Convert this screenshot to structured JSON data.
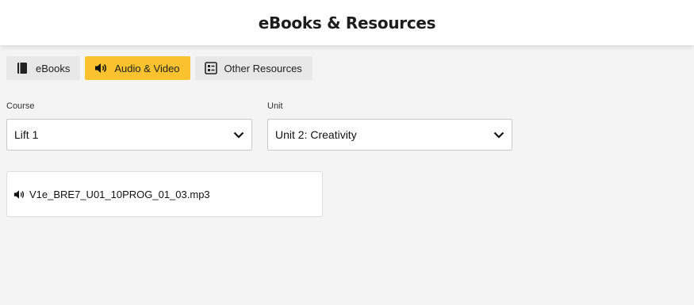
{
  "header": {
    "title": "eBooks & Resources"
  },
  "tabs": [
    {
      "label": "eBooks",
      "icon": "book-icon",
      "active": false
    },
    {
      "label": "Audio & Video",
      "icon": "speaker-icon",
      "active": true
    },
    {
      "label": "Other Resources",
      "icon": "document-list-icon",
      "active": false
    }
  ],
  "filters": {
    "course": {
      "label": "Course",
      "value": "Lift 1"
    },
    "unit": {
      "label": "Unit",
      "value": "Unit 2: Creativity"
    }
  },
  "resources": [
    {
      "icon": "speaker-icon",
      "filename": "V1e_BRE7_U01_10PROG_01_03.mp3"
    }
  ],
  "colors": {
    "accent": "#f9c22e",
    "tab_inactive": "#e8e8e8",
    "background": "#f4f4f4"
  }
}
